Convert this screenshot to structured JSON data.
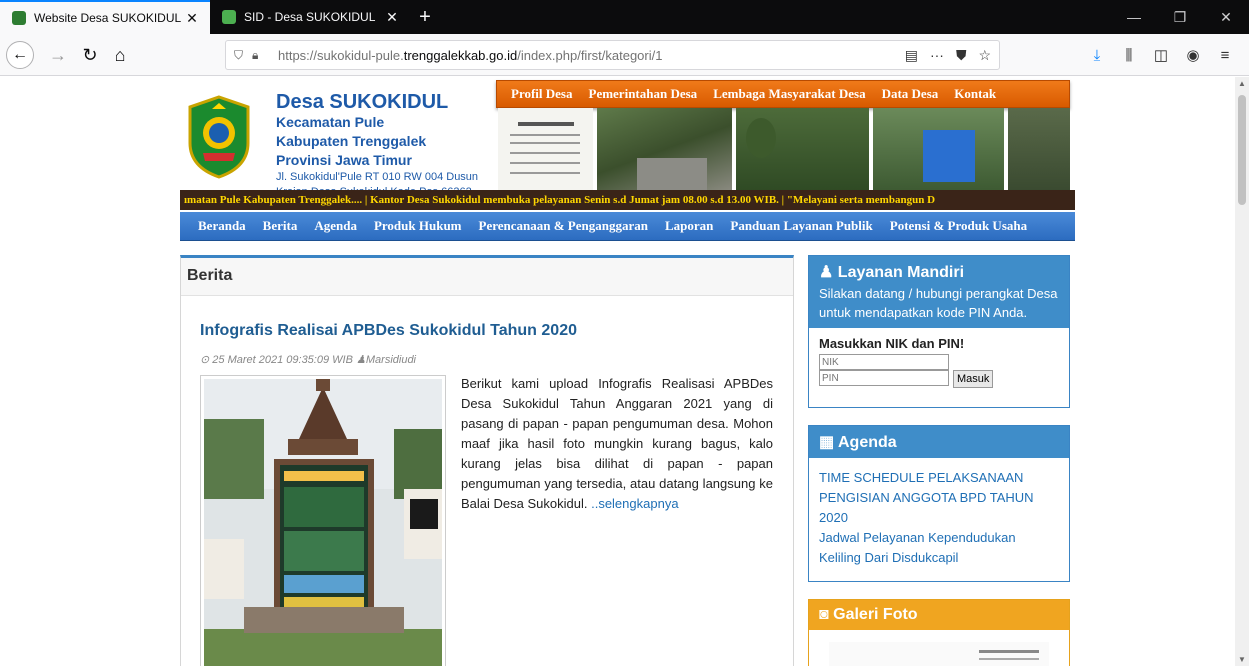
{
  "browser": {
    "tabs": [
      {
        "title": "Website Desa SUKOKIDUL",
        "active": true
      },
      {
        "title": "SID - Desa SUKOKIDUL",
        "active": false
      }
    ],
    "url_prefix": "https://sukokidul-pule.",
    "url_domain": "trenggalekkab.go.id",
    "url_path": "/index.php/first/kategori/1",
    "accent_color": "#0a84ff"
  },
  "header": {
    "village_name": "Desa SUKOKIDUL",
    "district": "Kecamatan Pule",
    "regency": "Kabupaten Trenggalek",
    "province": "Provinsi Jawa Timur",
    "address": "Jl. Sukokidul'Pule RT 010 RW 004 Dusun",
    "address2": "Krajan Desa Sukokidul Kode Pos 66362"
  },
  "top_menu": [
    "Profil Desa",
    "Pemerintahan Desa",
    "Lembaga Masyarakat Desa",
    "Data Desa",
    "Kontak"
  ],
  "ticker": "ımatan Pule Kabupaten Trenggalek....   |   Kantor Desa Sukokidul membuka pelayanan Senin s.d Jumat jam 08.00 s.d 13.00 WIB.   |   \"Melayani serta membangun D",
  "main_menu": [
    "Beranda",
    "Berita",
    "Agenda",
    "Produk Hukum",
    "Perencanaan & Penganggaran",
    "Laporan",
    "Panduan Layanan Publik",
    "Potensi & Produk Usaha"
  ],
  "content": {
    "section_title": "Berita",
    "post": {
      "title": "Infografis Realisai APBDes Sukokidul Tahun 2020",
      "meta": "25 Maret 2021 09:35:09 WIB",
      "author": "Marsidiudi",
      "body": "Berikut kami upload Infografis Realisasi APBDes Desa Sukokidul Tahun Anggaran 2021 yang di pasang di papan - papan pengumuman desa. Mohon maaf jika hasil foto mungkin kurang bagus, kalo kurang jelas bisa dilihat di papan - papan pengumuman yang tersedia, atau datang langsung ke Balai Desa Sukokidul.",
      "read_more": "..selengkapnya"
    }
  },
  "sidebar": {
    "layanan": {
      "title": "Layanan Mandiri",
      "subtitle": "Silakan datang / hubungi perangkat Desa untuk mendapatkan kode PIN Anda.",
      "form_label": "Masukkan NIK dan PIN!",
      "nik_placeholder": "NIK",
      "pin_placeholder": "PIN",
      "submit": "Masuk"
    },
    "agenda": {
      "title": "Agenda",
      "items": [
        "TIME SCHEDULE PELAKSANAAN PENGISIAN ANGGOTA BPD TAHUN 2020",
        "Jadwal Pelayanan Kependudukan Keliling Dari Disdukcapil"
      ]
    },
    "galeri": {
      "title": "Galeri Foto"
    }
  }
}
